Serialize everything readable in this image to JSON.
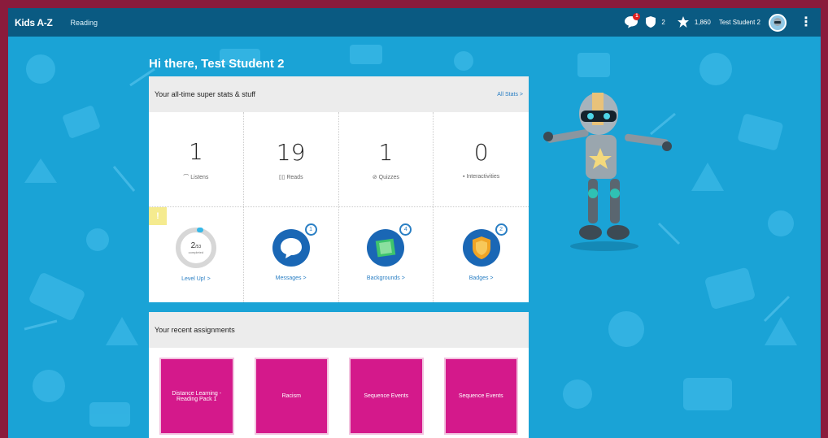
{
  "app": {
    "brand": "Kids A-Z",
    "nav_link": "Reading"
  },
  "topbar": {
    "message_badge": "1",
    "shield_count": "2",
    "stars_count": "1,860",
    "student_name": "Test Student 2"
  },
  "greeting": "Hi there, Test Student 2",
  "stats_panel": {
    "title": "Your all-time super stats & stuff",
    "all_stats_link": "All Stats >",
    "stats": [
      {
        "value": "1",
        "label": "Listens",
        "icon": "headphones-icon"
      },
      {
        "value": "19",
        "label": "Reads",
        "icon": "book-icon"
      },
      {
        "value": "1",
        "label": "Quizzes",
        "icon": "quiz-icon"
      },
      {
        "value": "0",
        "label": "Interactivities",
        "icon": "interactivity-icon"
      }
    ],
    "alert_mark": "!",
    "level": {
      "current": "2",
      "total": "/53",
      "sub": "completed",
      "link": "Level Up! >"
    },
    "features": [
      {
        "label": "Messages >",
        "badge": "1",
        "icon": "message-icon"
      },
      {
        "label": "Backgrounds >",
        "badge": "4",
        "icon": "backgrounds-icon"
      },
      {
        "label": "Badges >",
        "badge": "2",
        "icon": "badge-icon"
      }
    ]
  },
  "assignments_panel": {
    "title": "Your recent assignments",
    "cards": [
      "Distance Learning - Reading Pack 1",
      "Racism",
      "Sequence Events",
      "Sequence Events"
    ]
  },
  "colors": {
    "frame": "#8a1b3c",
    "topbar": "#0a5a82",
    "background": "#1aa3d6",
    "assignment_card": "#d4198b",
    "link": "#2a7fc4"
  }
}
